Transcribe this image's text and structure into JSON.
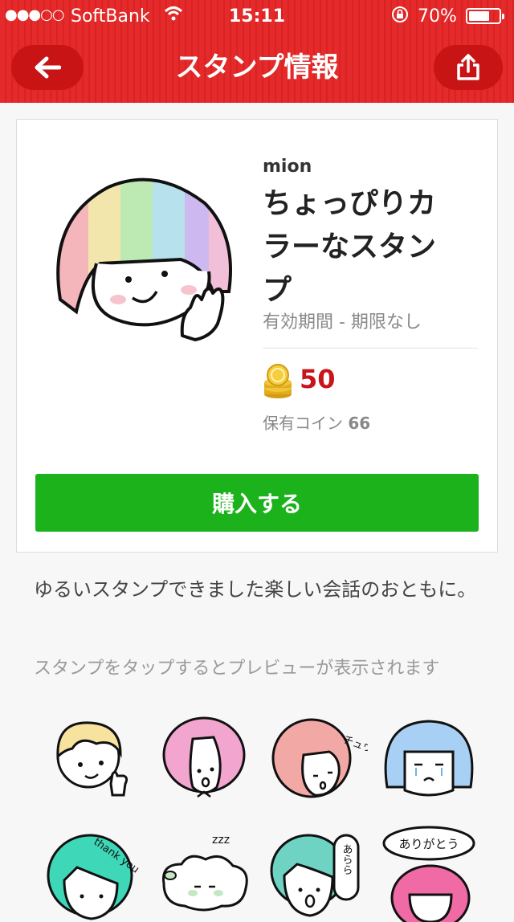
{
  "status_bar": {
    "signal": "●●●○○",
    "carrier": "SoftBank",
    "time": "15:11",
    "battery": "70%",
    "battery_level": 0.7
  },
  "header": {
    "title": "スタンプ情報",
    "back_icon": "arrow-left-icon",
    "share_icon": "share-icon",
    "accent_color": "#e42a2a"
  },
  "product": {
    "author": "mion",
    "title": "ちょっぴりカラーなスタンプ",
    "validity": "有効期間 - 期限なし",
    "price": "50",
    "owned_label": "保有コイン",
    "owned_coins": "66",
    "buy_label": "購入する",
    "buy_color": "#1bb21b",
    "price_color": "#c8151b"
  },
  "description": "ゆるいスタンプできました楽しい会話のおともに。",
  "preview_hint": "スタンプをタップするとプレビューが表示されます",
  "stickers": [
    {
      "name": "blonde-thumbs-up-sticker"
    },
    {
      "name": "pink-hair-sticker"
    },
    {
      "name": "salmon-hair-kiss-sticker",
      "text": "チュウ"
    },
    {
      "name": "blue-hair-crying-sticker"
    },
    {
      "name": "teal-hair-thank-you-sticker",
      "text": "thank you"
    },
    {
      "name": "sleeping-sheep-sticker",
      "text": "zzz"
    },
    {
      "name": "teal-hair-arara-sticker",
      "text": "あらら"
    },
    {
      "name": "arigatou-sticker",
      "text": "ありがとう"
    }
  ]
}
